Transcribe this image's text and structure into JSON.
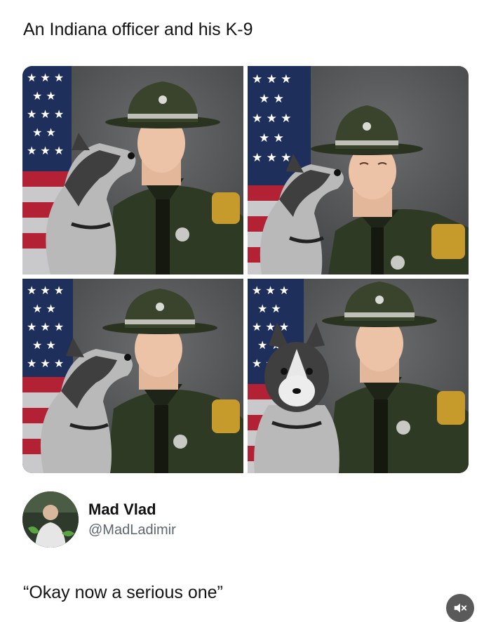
{
  "post": {
    "title": "An Indiana officer and his K-9",
    "caption": "“Okay now a serious one”"
  },
  "author": {
    "display_name": "Mad Vlad",
    "handle": "@MadLadimir"
  },
  "photos": [
    {
      "label": "photo-1"
    },
    {
      "label": "photo-2"
    },
    {
      "label": "photo-3"
    },
    {
      "label": "photo-4"
    }
  ],
  "icons": {
    "mute": "speaker-muted-icon"
  },
  "colors": {
    "uniform": "#2f3a24",
    "background": "#555759",
    "flag_blue": "#1f2f5c",
    "flag_red": "#b22234"
  }
}
